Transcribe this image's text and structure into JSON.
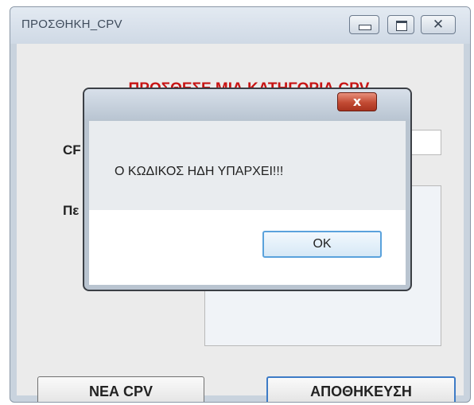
{
  "window": {
    "title": "ΠΡΟΣΘΗΚΗ_CPV",
    "controls": {
      "minimize_icon": "minimize-icon",
      "maximize_icon": "maximize-icon",
      "close_icon": "close-icon",
      "close_glyph": "✕"
    }
  },
  "form": {
    "heading": "ΠΡΟΣΘΕΣΕ ΜΙΑ ΚΑΤΗΓΟΡΙΑ CPV",
    "cpv_label": "CF",
    "description_label": "Πε",
    "cpv_value": "",
    "description_value": ""
  },
  "buttons": {
    "new_cpv": "ΝΕΑ CPV",
    "save": "ΑΠΟΘΗΚΕΥΣΗ"
  },
  "dialog": {
    "title": "",
    "message": "Ο ΚΩΔΙΚΟΣ ΗΔΗ ΥΠΑΡΧΕΙ!!!",
    "ok_label": "OK",
    "close_glyph": "x"
  },
  "colors": {
    "heading": "#c71414",
    "dialog_close": "#c24a33",
    "ok_focus": "#5aa2dc",
    "save_focus": "#3d7bc6"
  }
}
